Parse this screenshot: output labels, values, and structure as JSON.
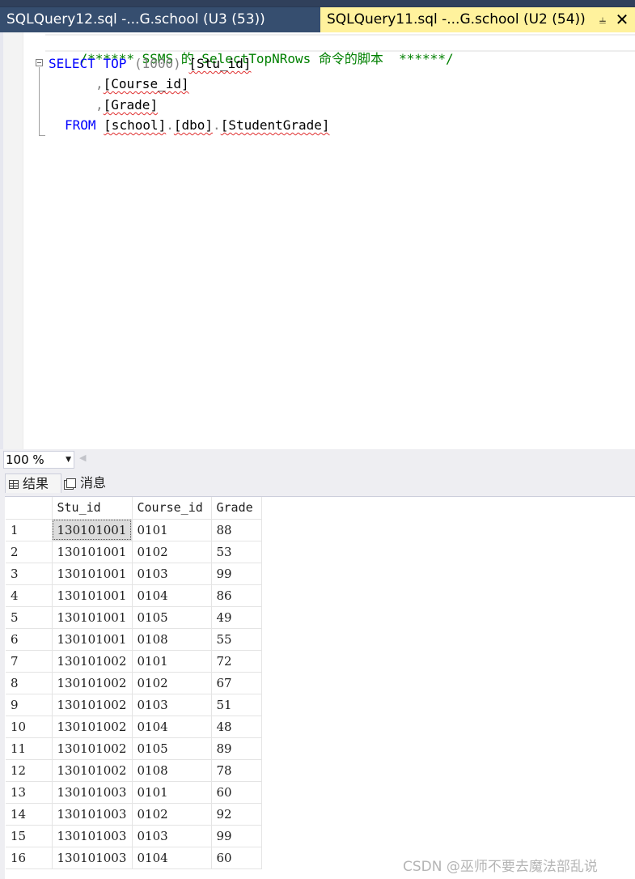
{
  "tabs": [
    {
      "label": "SQLQuery12.sql -...G.school (U3 (53))",
      "active": false
    },
    {
      "label": "SQLQuery11.sql -...G.school (U2 (54))",
      "active": true
    }
  ],
  "tab_icons": {
    "pin": "pin-icon",
    "close": "close-icon"
  },
  "editor": {
    "comment": "/****** SSMS 的 SelectTopNRows 命令的脚本  ******/",
    "select_kw": "SELECT",
    "top_kw": "TOP",
    "top_value": "(1000)",
    "col1": "[Stu_id]",
    "col2": "[Course_id]",
    "col3": "[Grade]",
    "comma": ",",
    "from_kw": "FROM",
    "from_db": "[school]",
    "from_schema": "[dbo]",
    "from_table": "[StudentGrade]",
    "dot": "."
  },
  "zoom": {
    "value": "100 %"
  },
  "result_tabs": [
    {
      "label": "结果",
      "icon": "grid-icon"
    },
    {
      "label": "消息",
      "icon": "message-icon"
    }
  ],
  "grid": {
    "columns": [
      "Stu_id",
      "Course_id",
      "Grade"
    ],
    "rows": [
      [
        "1",
        "130101001",
        "0101",
        "88"
      ],
      [
        "2",
        "130101001",
        "0102",
        "53"
      ],
      [
        "3",
        "130101001",
        "0103",
        "99"
      ],
      [
        "4",
        "130101001",
        "0104",
        "86"
      ],
      [
        "5",
        "130101001",
        "0105",
        "49"
      ],
      [
        "6",
        "130101001",
        "0108",
        "55"
      ],
      [
        "7",
        "130101002",
        "0101",
        "72"
      ],
      [
        "8",
        "130101002",
        "0102",
        "67"
      ],
      [
        "9",
        "130101002",
        "0103",
        "51"
      ],
      [
        "10",
        "130101002",
        "0104",
        "48"
      ],
      [
        "11",
        "130101002",
        "0105",
        "89"
      ],
      [
        "12",
        "130101002",
        "0108",
        "78"
      ],
      [
        "13",
        "130101003",
        "0101",
        "60"
      ],
      [
        "14",
        "130101003",
        "0102",
        "92"
      ],
      [
        "15",
        "130101003",
        "0103",
        "99"
      ],
      [
        "16",
        "130101003",
        "0104",
        "60"
      ]
    ]
  },
  "watermark": "CSDN @巫师不要去魔法部乱说",
  "colors": {
    "tabbar": "#293955",
    "active_tab": "#fff29d",
    "keyword": "#0000ff",
    "comment": "#008000"
  }
}
